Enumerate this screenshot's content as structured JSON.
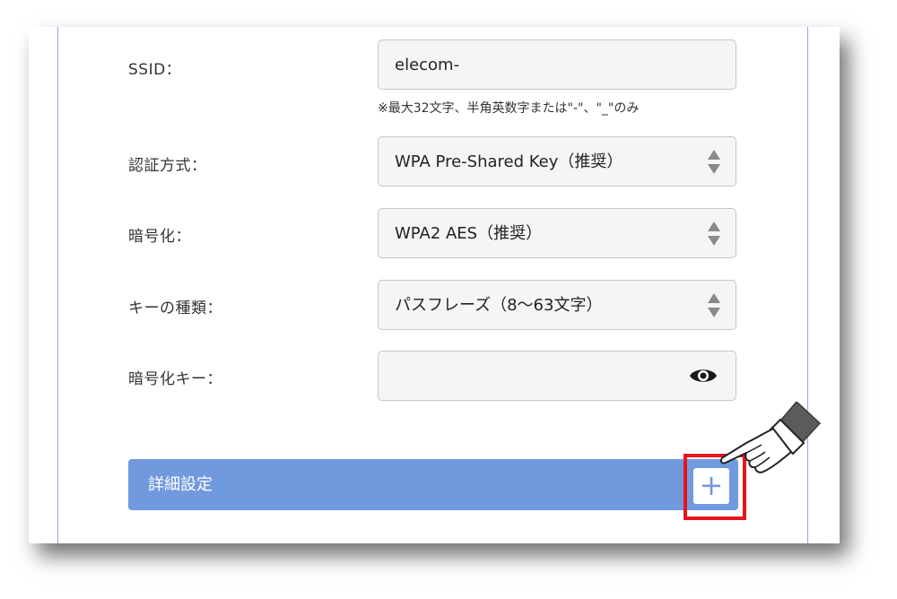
{
  "form": {
    "ssid": {
      "label": "SSID：",
      "value": "elecom-",
      "note": "※最大32文字、半角英数字または\"-\"、\"_\"のみ"
    },
    "auth": {
      "label": "認証方式：",
      "value": "WPA Pre-Shared Key（推奨）"
    },
    "encryption": {
      "label": "暗号化：",
      "value": "WPA2 AES（推奨）"
    },
    "key_type": {
      "label": "キーの種類：",
      "value": "パスフレーズ（8〜63文字）"
    },
    "key": {
      "label": "暗号化キー：",
      "value": "",
      "icon": "eye-icon"
    }
  },
  "advanced": {
    "title": "詳細設定",
    "expand_label": "+",
    "expand_icon": "plus-icon"
  },
  "annotation": {
    "icon": "pointing-hand-icon",
    "highlight_color": "#e8141b"
  },
  "colors": {
    "accent": "#7199dd",
    "field_bg": "#f5f5f5",
    "border": "#c6c6c6"
  }
}
